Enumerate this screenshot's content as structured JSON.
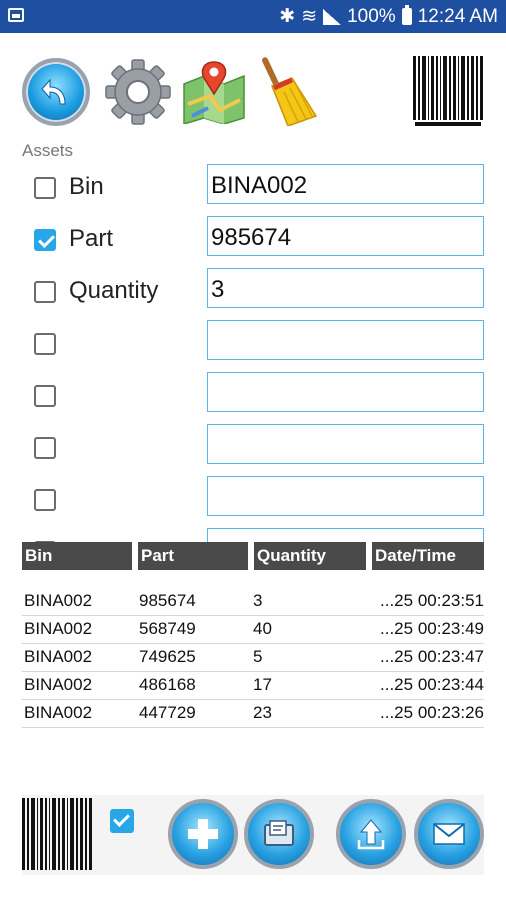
{
  "status_bar": {
    "battery": "100%",
    "time": "12:24 AM",
    "icons": [
      "image-icon",
      "bluetooth-icon",
      "wifi-icon",
      "signal-icon",
      "battery-icon"
    ]
  },
  "toolbar": {
    "icons": [
      "back-icon",
      "settings-gear-icon",
      "map-icon",
      "broom-icon",
      "barcode-icon"
    ]
  },
  "assets_label": "Assets",
  "fields": [
    {
      "label": "Bin",
      "checked": false,
      "value": "BINA002"
    },
    {
      "label": "Part",
      "checked": true,
      "value": "985674"
    },
    {
      "label": "Quantity",
      "checked": false,
      "value": "3"
    },
    {
      "label": "",
      "checked": false,
      "value": ""
    },
    {
      "label": "",
      "checked": false,
      "value": ""
    },
    {
      "label": "",
      "checked": false,
      "value": ""
    },
    {
      "label": "",
      "checked": false,
      "value": ""
    }
  ],
  "table": {
    "headers": [
      "Bin",
      "Part",
      "Quantity",
      "Date/Time"
    ],
    "rows": [
      [
        "BINA002",
        "985674",
        "3",
        "...25 00:23:51"
      ],
      [
        "BINA002",
        "568749",
        "40",
        "...25 00:23:49"
      ],
      [
        "BINA002",
        "749625",
        "5",
        "...25 00:23:47"
      ],
      [
        "BINA002",
        "486168",
        "17",
        "...25 00:23:44"
      ],
      [
        "BINA002",
        "447729",
        "23",
        "...25 00:23:26"
      ]
    ]
  },
  "bottom_bar": {
    "checkbox_checked": true,
    "icons": [
      "barcode-icon",
      "add-icon",
      "folder-icon",
      "upload-icon",
      "email-icon"
    ]
  },
  "colors": {
    "status_bar": "#1f4fa0",
    "accent": "#27a7e8",
    "field_border": "#5ab4e8",
    "table_header": "#4a4a4a"
  }
}
